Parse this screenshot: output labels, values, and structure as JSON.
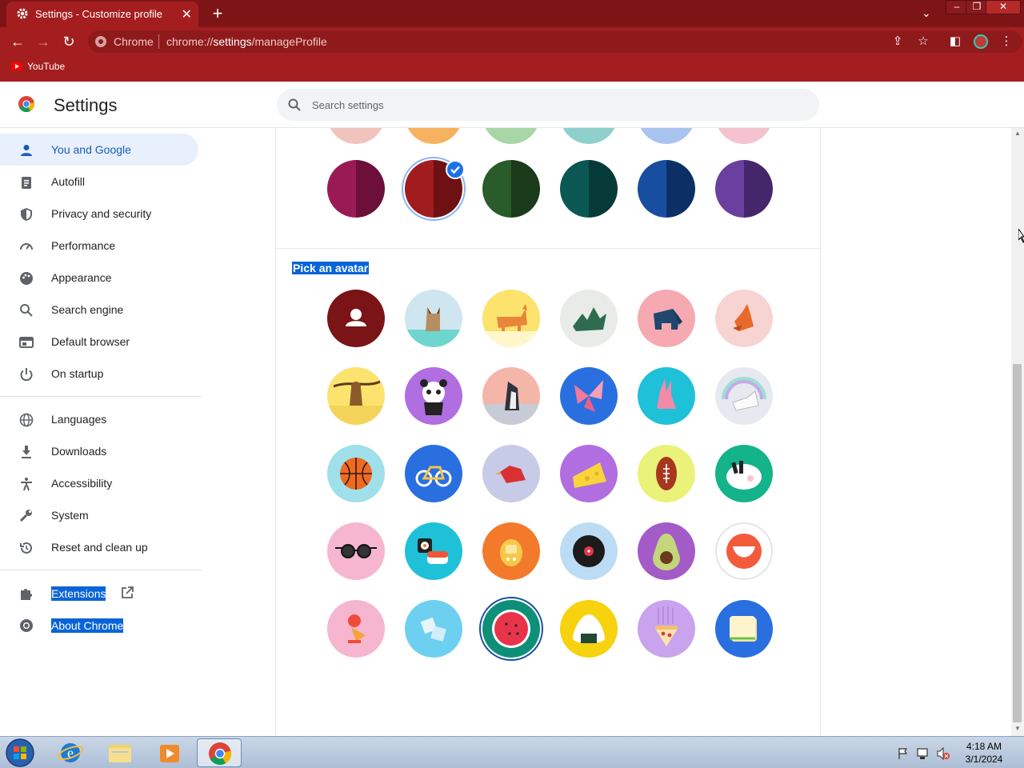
{
  "browser": {
    "tab_title": "Settings - Customize profile",
    "new_tab_symbol": "+",
    "url_chip": "Chrome",
    "url_scheme": "chrome://",
    "url_host": "settings",
    "url_path": "/manageProfile",
    "bookmarks": [
      {
        "label": "YouTube"
      }
    ],
    "theme_color": "#a51e1f"
  },
  "settings": {
    "title": "Settings",
    "search_placeholder": "Search settings",
    "nav": [
      {
        "label": "You and Google",
        "icon": "person-icon",
        "active": true
      },
      {
        "label": "Autofill",
        "icon": "clipboard-icon"
      },
      {
        "label": "Privacy and security",
        "icon": "shield-icon"
      },
      {
        "label": "Performance",
        "icon": "speedometer-icon"
      },
      {
        "label": "Appearance",
        "icon": "palette-icon"
      },
      {
        "label": "Search engine",
        "icon": "search-icon"
      },
      {
        "label": "Default browser",
        "icon": "browser-window-icon"
      },
      {
        "label": "On startup",
        "icon": "power-icon"
      },
      {
        "label": "Languages",
        "icon": "globe-icon"
      },
      {
        "label": "Downloads",
        "icon": "download-icon"
      },
      {
        "label": "Accessibility",
        "icon": "accessibility-icon"
      },
      {
        "label": "System",
        "icon": "wrench-icon"
      },
      {
        "label": "Reset and clean up",
        "icon": "reset-icon"
      },
      {
        "label": "Extensions",
        "icon": "puzzle-icon"
      },
      {
        "label": "About Chrome",
        "icon": "chrome-icon"
      }
    ],
    "color_row": [
      {
        "light": "#9a1a55",
        "dark": "#6c0f3a"
      },
      {
        "light": "#a11c1f",
        "dark": "#6d1113",
        "selected": true
      },
      {
        "light": "#2a5b2a",
        "dark": "#1a3a1a"
      },
      {
        "light": "#0b5754",
        "dark": "#053a38"
      },
      {
        "light": "#174ea0",
        "dark": "#0c3066"
      },
      {
        "light": "#6a3fa0",
        "dark": "#44276a"
      }
    ],
    "pick_avatar_label": "Pick an avatar",
    "avatars": [
      "default-person",
      "cat",
      "corgi",
      "dragon",
      "elephant",
      "fox",
      "monkey",
      "panda",
      "penguin",
      "butterfly",
      "rabbit",
      "unicorn",
      "basketball",
      "bicycle",
      "bird",
      "cheese",
      "football",
      "ramen",
      "sunglasses",
      "sushi",
      "tamagotchi",
      "vinyl-record",
      "avocado",
      "smiley",
      "ice-cream",
      "ice-cubes",
      "watermelon",
      "onigiri",
      "pizza",
      "sandwich"
    ]
  },
  "taskbar": {
    "time": "4:18 AM",
    "date": "3/1/2024"
  }
}
